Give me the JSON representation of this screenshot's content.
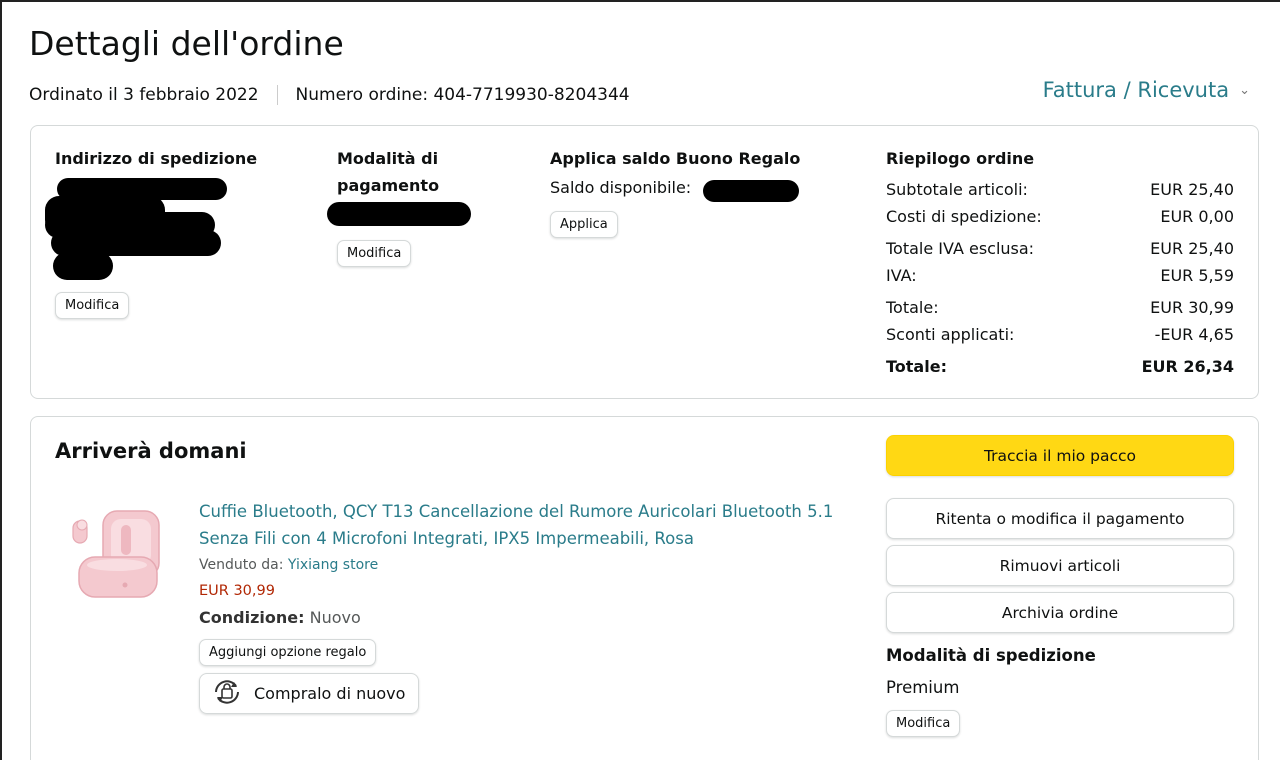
{
  "header": {
    "title": "Dettagli dell'ordine",
    "ordered_on": "Ordinato il 3 febbraio 2022",
    "order_number": "Numero ordine: 404-7719930-8204344",
    "invoice_link": "Fattura / Ricevuta"
  },
  "shipping_address": {
    "title": "Indirizzo di spedizione",
    "edit_label": "Modifica"
  },
  "payment": {
    "title": "Modalità di pagamento",
    "edit_label": "Modifica"
  },
  "gift_card": {
    "title": "Applica saldo Buono Regalo",
    "balance_label": "Saldo disponibile:",
    "apply_label": "Applica"
  },
  "summary": {
    "title": "Riepilogo ordine",
    "rows": [
      {
        "label": "Subtotale articoli:",
        "value": "EUR 25,40"
      },
      {
        "label": "Costi di spedizione:",
        "value": "EUR 0,00"
      },
      {
        "label": "Totale IVA esclusa:",
        "value": "EUR 25,40"
      },
      {
        "label": "IVA:",
        "value": "EUR 5,59"
      },
      {
        "label": "Totale:",
        "value": "EUR 30,99"
      },
      {
        "label": "Sconti applicati:",
        "value": "-EUR 4,65"
      },
      {
        "label": "Totale:",
        "value": "EUR 26,34"
      }
    ]
  },
  "shipment": {
    "title": "Arriverà domani",
    "product": {
      "title": "Cuffie Bluetooth, QCY T13 Cancellazione del Rumore Auricolari Bluetooth 5.1 Senza Fili con 4 Microfoni Integrati, IPX5 Impermeabili, Rosa",
      "sold_by_label": "Venduto da:",
      "seller": "Yixiang store",
      "price": "EUR 30,99",
      "condition_label": "Condizione:",
      "condition_value": "Nuovo",
      "gift_option_label": "Aggiungi opzione regalo",
      "buy_again_label": "Compralo di nuovo",
      "image_color": "#f4c9cf"
    },
    "actions": {
      "track": "Traccia il mio pacco",
      "retry_payment": "Ritenta o modifica il pagamento",
      "remove_items": "Rimuovi articoli",
      "archive": "Archivia ordine"
    },
    "shipping_method": {
      "title": "Modalità di spedizione",
      "value": "Premium",
      "edit_label": "Modifica"
    }
  },
  "colors": {
    "link": "#2a7c8a",
    "price": "#b12704",
    "primary_button": "#ffd814"
  }
}
